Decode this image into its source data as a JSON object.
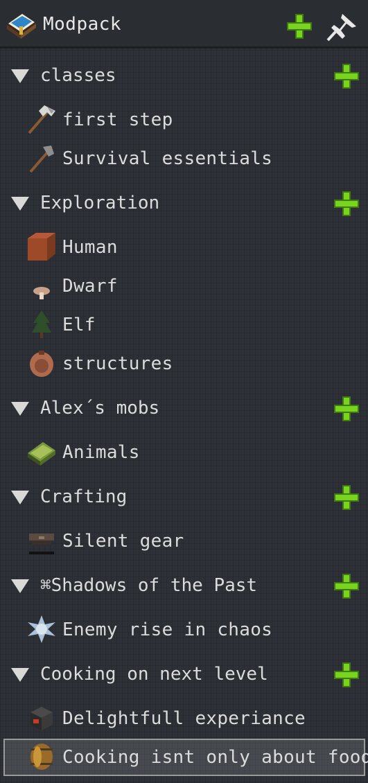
{
  "header": {
    "title": "Modpack",
    "add_icon": "plus-icon",
    "pin_icon": "pin-icon"
  },
  "colors": {
    "accent_plus": "#7ad321",
    "text": "#dcdcdc",
    "background": "#2d3036"
  },
  "chapters": [
    {
      "title": "classes",
      "quests": [
        {
          "label": "first step",
          "icon": "battle-axe-icon"
        },
        {
          "label": "Survival essentials",
          "icon": "stone-axe-icon"
        }
      ]
    },
    {
      "title": "Exploration",
      "quests": [
        {
          "label": "Human",
          "icon": "terracotta-block-icon"
        },
        {
          "label": "Dwarf",
          "icon": "mushroom-icon"
        },
        {
          "label": "Elf",
          "icon": "spruce-sapling-icon"
        },
        {
          "label": "structures",
          "icon": "backpack-icon"
        }
      ]
    },
    {
      "title": "Alex´s mobs",
      "quests": [
        {
          "label": "Animals",
          "icon": "green-book-icon"
        }
      ]
    },
    {
      "title": "Crafting",
      "quests": [
        {
          "label": "Silent gear",
          "icon": "workbench-icon"
        }
      ]
    },
    {
      "title": "Shadows of the Past",
      "title_prefix": "⌘",
      "quests": [
        {
          "label": "Enemy rise in chaos",
          "icon": "blue-star-icon"
        }
      ]
    },
    {
      "title": "Cooking on next level",
      "quests": [
        {
          "label": "Delightfull experiance",
          "icon": "stove-icon"
        },
        {
          "label": "Cooking isnt only about food",
          "icon": "barrel-icon",
          "selected": true
        }
      ]
    }
  ]
}
